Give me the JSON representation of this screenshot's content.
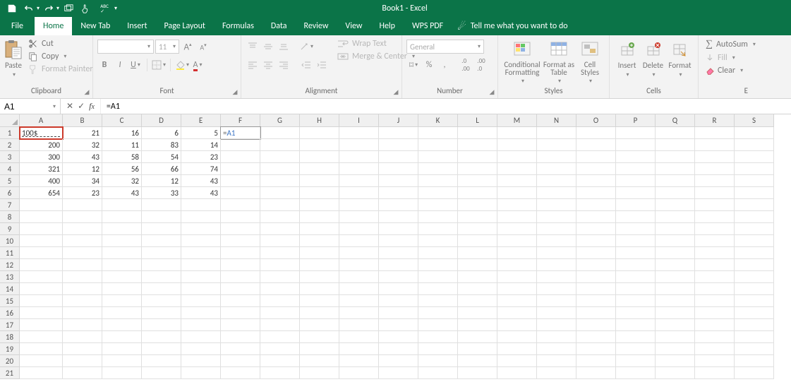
{
  "title": "Book1  -  Excel",
  "qat": {
    "save_tip": "Save",
    "undo_tip": "Undo",
    "redo_tip": "Redo"
  },
  "tabs": {
    "file": "File",
    "home": "Home",
    "newtab": "New Tab",
    "insert": "Insert",
    "pagelayout": "Page Layout",
    "formulas": "Formulas",
    "data": "Data",
    "review": "Review",
    "view": "View",
    "help": "Help",
    "wps": "WPS PDF",
    "tellme": "Tell me what you want to do"
  },
  "ribbon": {
    "clipboard": {
      "label": "Clipboard",
      "paste": "Paste",
      "cut": "Cut",
      "copy": "Copy",
      "painter": "Format Painter"
    },
    "font": {
      "label": "Font",
      "name": "",
      "size": "11"
    },
    "alignment": {
      "label": "Alignment",
      "wrap": "Wrap Text",
      "merge": "Merge & Center"
    },
    "number": {
      "label": "Number",
      "format": "General",
      "pct": "%",
      "comma": ","
    },
    "styles": {
      "label": "Styles",
      "cond": "Conditional Formatting",
      "table": "Format as Table",
      "cell": "Cell Styles"
    },
    "cells": {
      "label": "Cells",
      "insert": "Insert",
      "delete": "Delete",
      "format": "Format"
    },
    "editing": {
      "label": "E",
      "autosum": "AutoSum",
      "fill": "Fill",
      "clear": "Clear"
    }
  },
  "formula_bar": {
    "name_box": "A1",
    "formula": "=A1"
  },
  "columns": [
    "A",
    "B",
    "C",
    "D",
    "E",
    "F",
    "G",
    "H",
    "I",
    "J",
    "K",
    "L",
    "M",
    "N",
    "O",
    "P",
    "Q",
    "R",
    "S"
  ],
  "row_count": 21,
  "editing_cell": {
    "row": 1,
    "col": "F",
    "prefix": "=",
    "ref": "A1"
  },
  "highlight_cell": {
    "row": 1,
    "col": "A"
  },
  "data_cells": {
    "1": {
      "A": "100$",
      "B": "21",
      "C": "16",
      "D": "6",
      "E": "5"
    },
    "2": {
      "A": "200",
      "B": "32",
      "C": "11",
      "D": "83",
      "E": "14"
    },
    "3": {
      "A": "300",
      "B": "43",
      "C": "58",
      "D": "54",
      "E": "23"
    },
    "4": {
      "A": "321",
      "B": "12",
      "C": "56",
      "D": "66",
      "E": "74"
    },
    "5": {
      "A": "400",
      "B": "34",
      "C": "32",
      "D": "12",
      "E": "43"
    },
    "6": {
      "A": "654",
      "B": "23",
      "C": "43",
      "D": "33",
      "E": "43"
    }
  }
}
